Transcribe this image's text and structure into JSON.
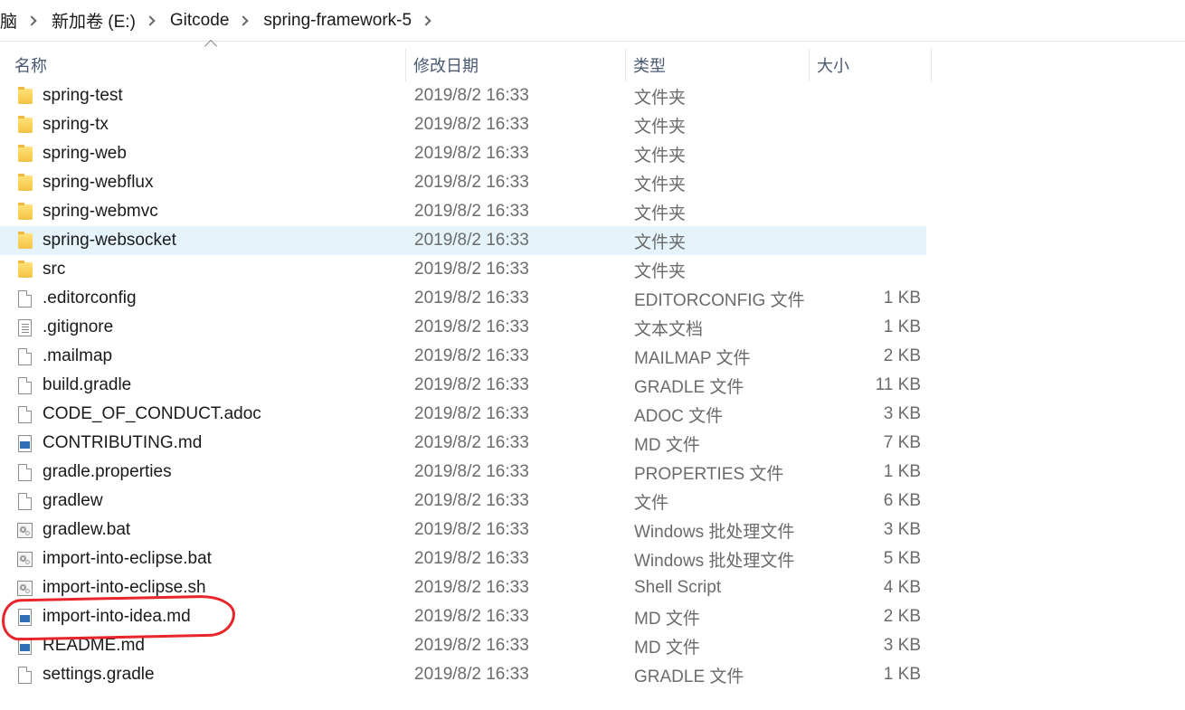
{
  "breadcrumb": [
    {
      "label": "脑"
    },
    {
      "label": "新加卷 (E:)"
    },
    {
      "label": "Gitcode"
    },
    {
      "label": "spring-framework-5"
    }
  ],
  "columns": {
    "name": "名称",
    "date": "修改日期",
    "type": "类型",
    "size": "大小"
  },
  "accent": {
    "selected_row": "#e5f3fb",
    "highlight_circle": "#e8252b"
  },
  "files": [
    {
      "name": "spring-test",
      "date": "2019/8/2 16:33",
      "type": "文件夹",
      "size": "",
      "icon": "folder-icon"
    },
    {
      "name": "spring-tx",
      "date": "2019/8/2 16:33",
      "type": "文件夹",
      "size": "",
      "icon": "folder-icon"
    },
    {
      "name": "spring-web",
      "date": "2019/8/2 16:33",
      "type": "文件夹",
      "size": "",
      "icon": "folder-icon"
    },
    {
      "name": "spring-webflux",
      "date": "2019/8/2 16:33",
      "type": "文件夹",
      "size": "",
      "icon": "folder-icon"
    },
    {
      "name": "spring-webmvc",
      "date": "2019/8/2 16:33",
      "type": "文件夹",
      "size": "",
      "icon": "folder-icon"
    },
    {
      "name": "spring-websocket",
      "date": "2019/8/2 16:33",
      "type": "文件夹",
      "size": "",
      "icon": "folder-icon",
      "selected": true
    },
    {
      "name": "src",
      "date": "2019/8/2 16:33",
      "type": "文件夹",
      "size": "",
      "icon": "folder-icon"
    },
    {
      "name": ".editorconfig",
      "date": "2019/8/2 16:33",
      "type": "EDITORCONFIG 文件",
      "size": "1 KB",
      "icon": "file-icon"
    },
    {
      "name": ".gitignore",
      "date": "2019/8/2 16:33",
      "type": "文本文档",
      "size": "1 KB",
      "icon": "text-file-icon"
    },
    {
      "name": ".mailmap",
      "date": "2019/8/2 16:33",
      "type": "MAILMAP 文件",
      "size": "2 KB",
      "icon": "file-icon"
    },
    {
      "name": "build.gradle",
      "date": "2019/8/2 16:33",
      "type": "GRADLE 文件",
      "size": "11 KB",
      "icon": "file-icon"
    },
    {
      "name": "CODE_OF_CONDUCT.adoc",
      "date": "2019/8/2 16:33",
      "type": "ADOC 文件",
      "size": "3 KB",
      "icon": "file-icon"
    },
    {
      "name": "CONTRIBUTING.md",
      "date": "2019/8/2 16:33",
      "type": "MD 文件",
      "size": "7 KB",
      "icon": "markdown-file-icon"
    },
    {
      "name": "gradle.properties",
      "date": "2019/8/2 16:33",
      "type": "PROPERTIES 文件",
      "size": "1 KB",
      "icon": "file-icon"
    },
    {
      "name": "gradlew",
      "date": "2019/8/2 16:33",
      "type": "文件",
      "size": "6 KB",
      "icon": "file-icon"
    },
    {
      "name": "gradlew.bat",
      "date": "2019/8/2 16:33",
      "type": "Windows 批处理文件",
      "size": "3 KB",
      "icon": "batch-file-icon"
    },
    {
      "name": "import-into-eclipse.bat",
      "date": "2019/8/2 16:33",
      "type": "Windows 批处理文件",
      "size": "5 KB",
      "icon": "batch-file-icon"
    },
    {
      "name": "import-into-eclipse.sh",
      "date": "2019/8/2 16:33",
      "type": "Shell Script",
      "size": "4 KB",
      "icon": "batch-file-icon"
    },
    {
      "name": "import-into-idea.md",
      "date": "2019/8/2 16:33",
      "type": "MD 文件",
      "size": "2 KB",
      "icon": "markdown-file-icon",
      "highlighted": true
    },
    {
      "name": "README.md",
      "date": "2019/8/2 16:33",
      "type": "MD 文件",
      "size": "3 KB",
      "icon": "markdown-file-icon"
    },
    {
      "name": "settings.gradle",
      "date": "2019/8/2 16:33",
      "type": "GRADLE 文件",
      "size": "1 KB",
      "icon": "file-icon"
    }
  ]
}
